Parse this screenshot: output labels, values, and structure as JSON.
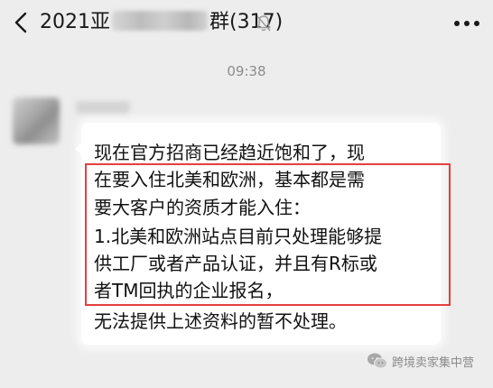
{
  "header": {
    "title_prefix": "< 2021亚",
    "title_suffix": "群(317)",
    "back_icon": "chevron-left-icon",
    "mute_icon": "bell-off-icon",
    "more_icon": "ellipsis-icon"
  },
  "chat": {
    "timestamp": "09:38",
    "message_lines": [
      "现在官方招商已经趋近饱和了，现",
      "在要入住北美和欧洲，基本都是需",
      "要大客户的资质才能入住：",
      "1.北美和欧洲站点目前只处理能够提",
      "供工厂或者产品认证，并且有R标或",
      "者TM回执的企业报名，",
      "无法提供上述资料的暂不处理。"
    ],
    "highlight_color": "#e53f3f"
  },
  "watermark": {
    "text": "跨境卖家集中营",
    "icon": "wechat-logo-icon"
  },
  "colors": {
    "background": "#ededed",
    "bubble": "#ffffff",
    "text": "#111111",
    "timestamp": "#8c8c8c"
  }
}
